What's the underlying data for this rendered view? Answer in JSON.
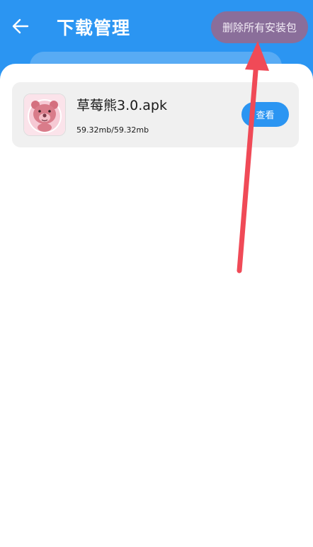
{
  "header": {
    "title": "下载管理",
    "back_icon": "arrow-left-icon",
    "delete_all_label": "删除所有安装包"
  },
  "downloads": [
    {
      "name": "草莓熊3.0.apk",
      "size": "59.32mb/59.32mb",
      "progress": 1.0,
      "action_label": "查看",
      "icon": "strawberry-bear-icon"
    }
  ],
  "colors": {
    "header_bg": "#2b95f2",
    "accent": "#2b95f2",
    "delete_button_bg": "#8a6e9a",
    "card_bg": "#f0f0f0",
    "annotation_arrow": "#f04a57"
  }
}
